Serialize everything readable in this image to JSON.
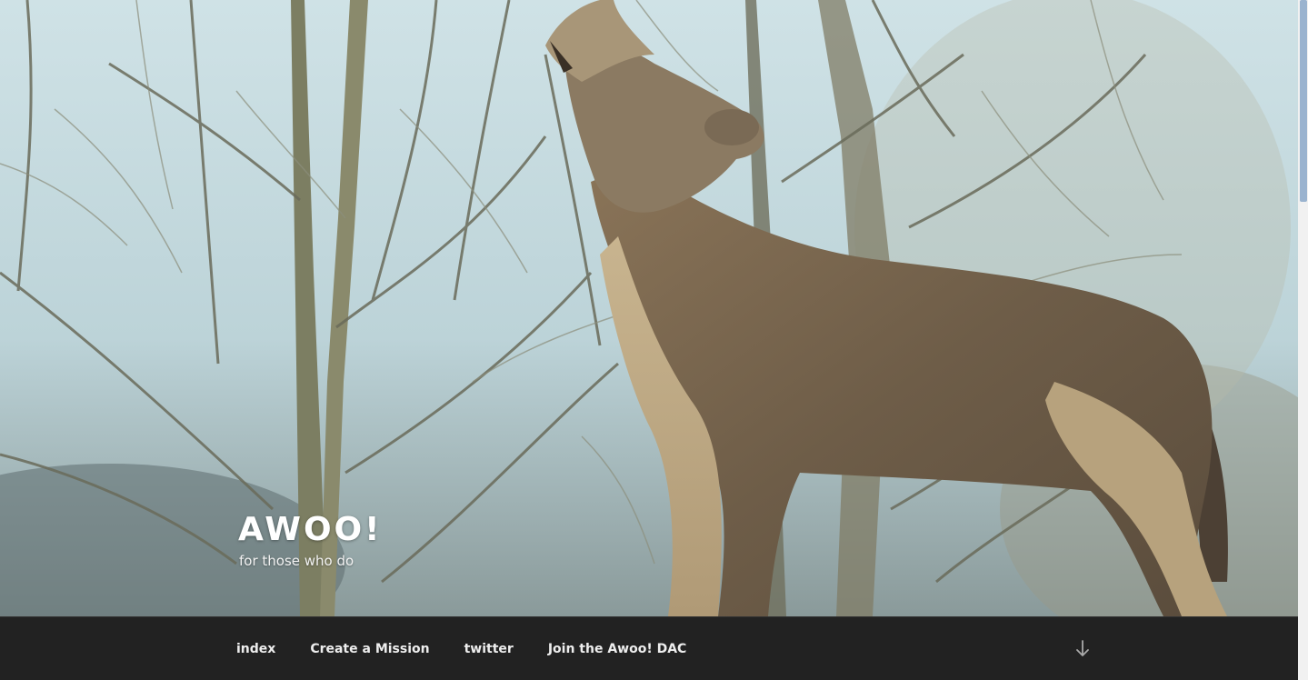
{
  "site": {
    "title": "AWOO!",
    "description": "for those who do"
  },
  "header_image": {
    "subject": "howling gray wolf among bare trees"
  },
  "navigation": {
    "items": [
      {
        "label": "index"
      },
      {
        "label": "Create a Mission"
      },
      {
        "label": "twitter"
      },
      {
        "label": "Join the Awoo! DAC"
      }
    ],
    "scroll_icon": "arrow-down-icon"
  },
  "colors": {
    "nav_background": "#222222",
    "nav_text": "#eeeeee",
    "title_text": "#ffffff",
    "scrollbar_thumb": "#9ab3cf"
  }
}
